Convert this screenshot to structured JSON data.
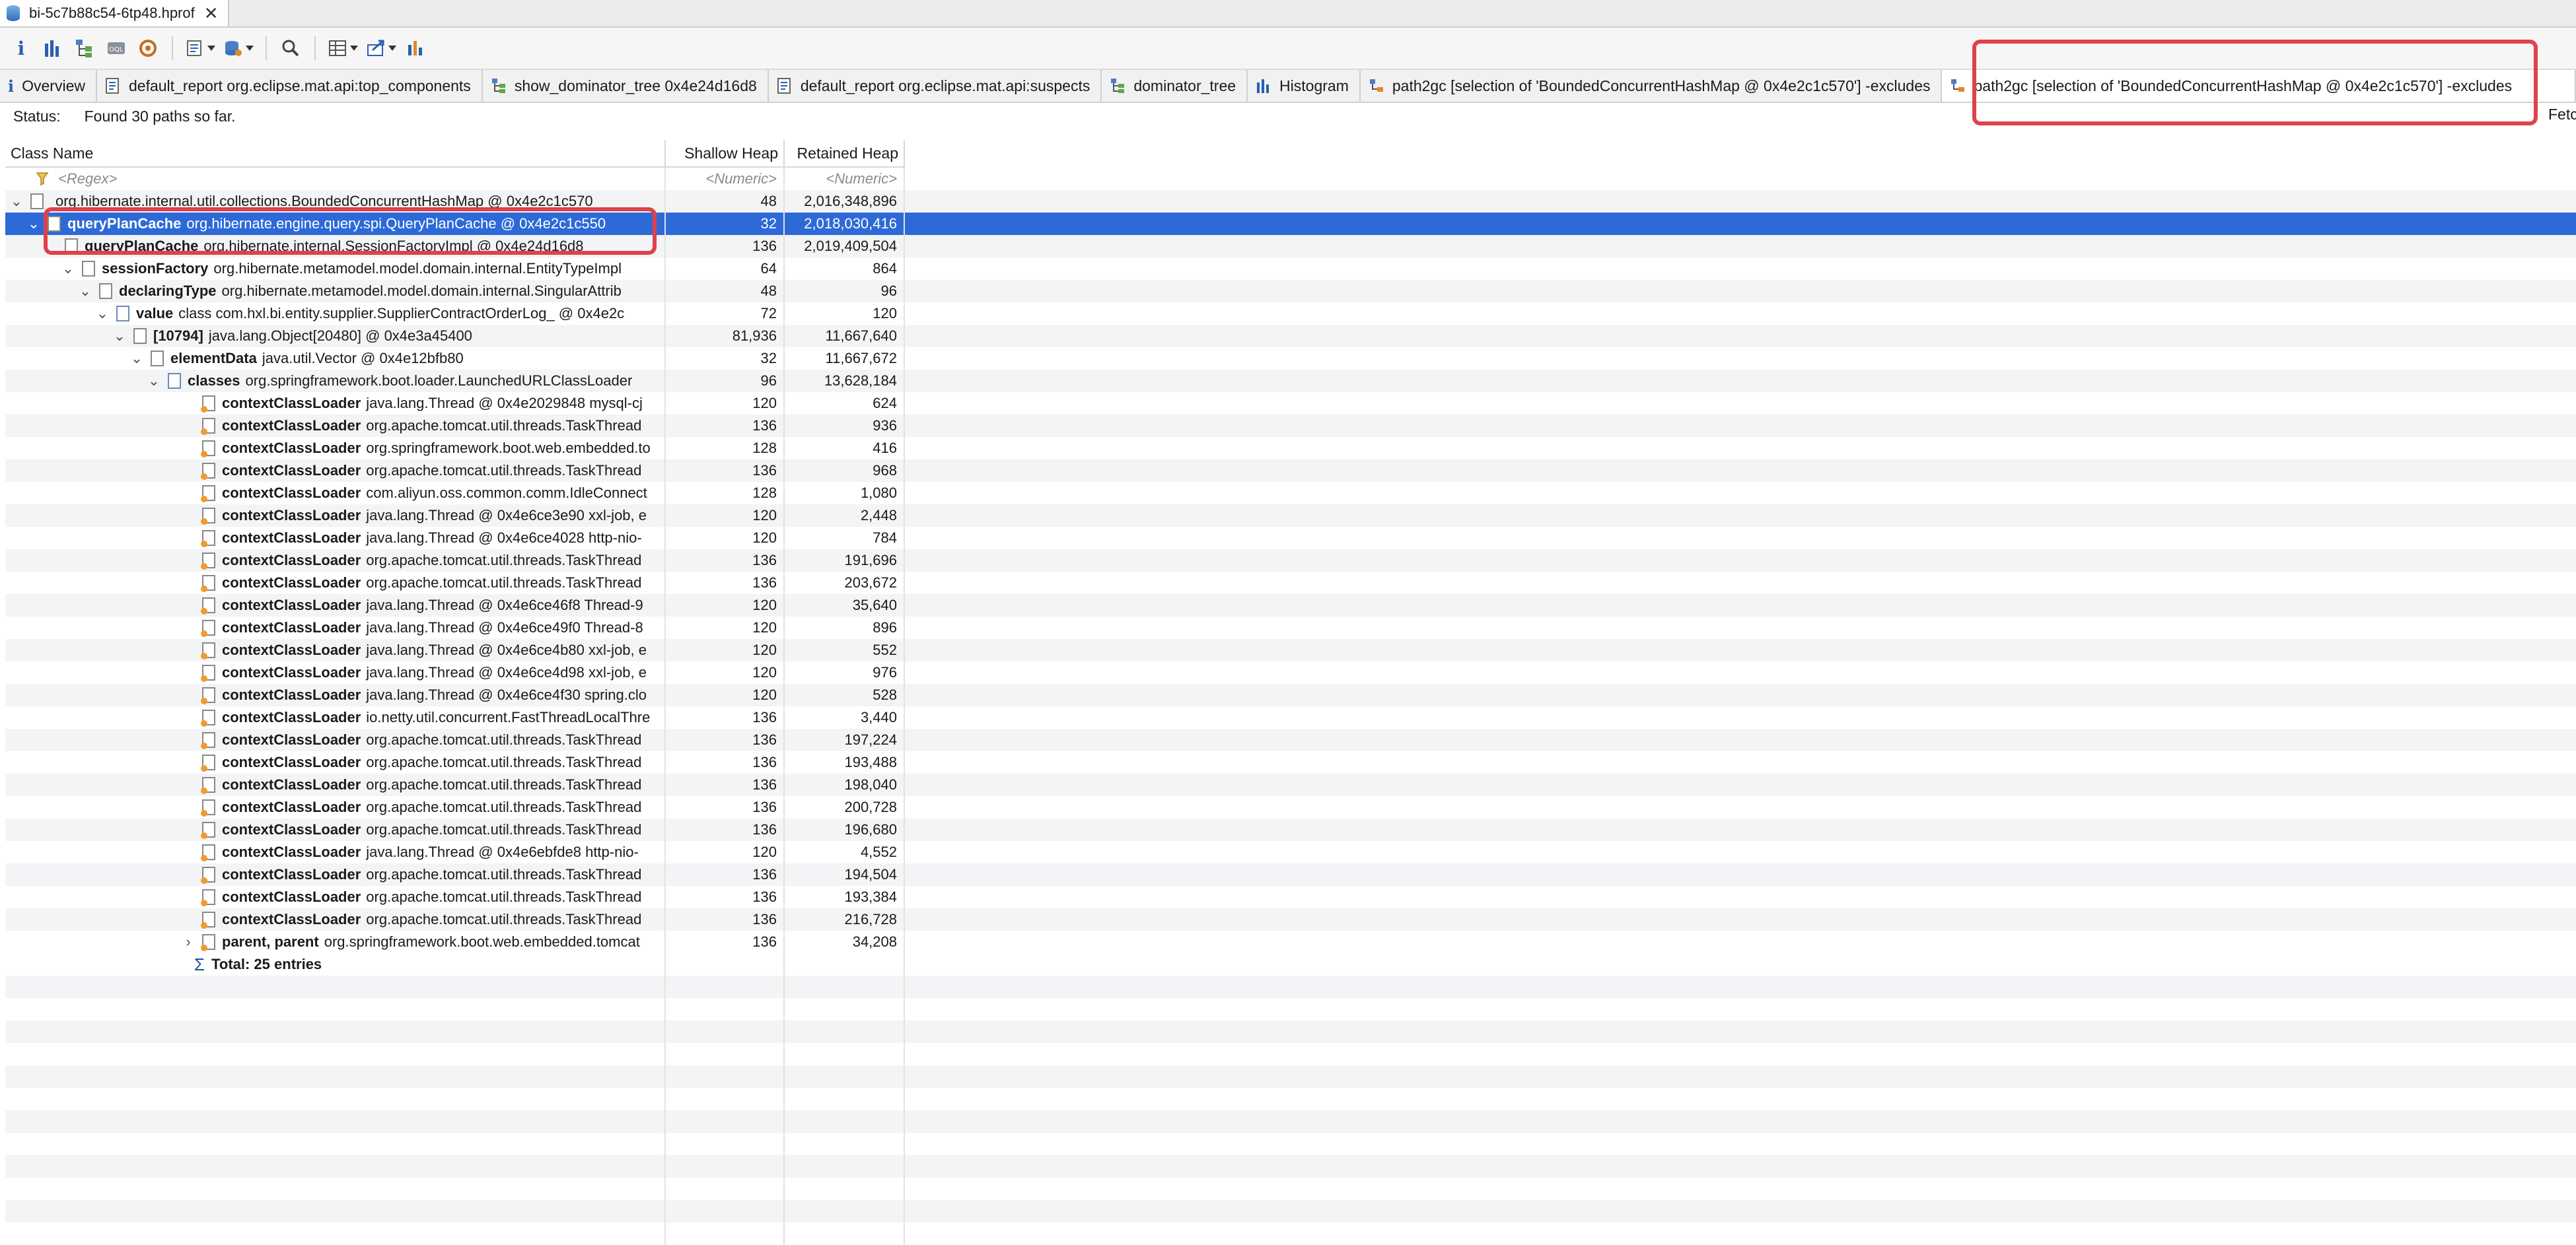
{
  "file_tab": {
    "title": "bi-5c7b88c54-6tp48.hprof",
    "close": "✕"
  },
  "toolbar": {
    "icons": [
      "info-icon",
      "histogram-icon",
      "dominator-tree-icon",
      "oql-icon",
      "thread-overview-icon",
      "run-report-icon",
      "query-browser-icon",
      "search-icon",
      "grouping-icon",
      "export-icon",
      "compare-icon"
    ]
  },
  "tabs": [
    {
      "label": "Overview",
      "icon": "info-icon"
    },
    {
      "label": "default_report org.eclipse.mat.api:top_components",
      "icon": "report-icon"
    },
    {
      "label": "show_dominator_tree 0x4e24d16d8",
      "icon": "dominator-tree-icon"
    },
    {
      "label": "default_report org.eclipse.mat.api:suspects",
      "icon": "report-icon"
    },
    {
      "label": "dominator_tree",
      "icon": "dominator-tree-icon"
    },
    {
      "label": "Histogram",
      "icon": "histogram-icon"
    },
    {
      "label": "path2gc [selection of 'BoundedConcurrentHashMap @ 0x4e2c1c570'] -excludes",
      "icon": "path2gc-icon"
    },
    {
      "label": "path2gc [selection of 'BoundedConcurrentHashMap @ 0x4e2c1c570'] -excludes",
      "icon": "path2gc-icon"
    }
  ],
  "status": {
    "label": "Status:",
    "text": "Found 30 paths so far.",
    "fetch": "Fetc"
  },
  "columns": {
    "class_name": "Class Name",
    "shallow": "Shallow Heap",
    "retained": "Retained Heap"
  },
  "filter": {
    "regex": "<Regex>",
    "numeric1": "<Numeric>",
    "numeric2": "<Numeric>"
  },
  "rows": [
    {
      "field": "",
      "cls": "org.hibernate.internal.util.collections.BoundedConcurrentHashMap @ 0x4e2c1c570",
      "shallow": "48",
      "retained": "2,016,348,896"
    },
    {
      "field": "queryPlanCache",
      "cls": "org.hibernate.engine.query.spi.QueryPlanCache @ 0x4e2c1c550",
      "shallow": "32",
      "retained": "2,018,030,416"
    },
    {
      "field": "queryPlanCache",
      "cls": "org.hibernate.internal.SessionFactoryImpl @ 0x4e24d16d8",
      "shallow": "136",
      "retained": "2,019,409,504"
    },
    {
      "field": "sessionFactory",
      "cls": "org.hibernate.metamodel.model.domain.internal.EntityTypeImpl",
      "shallow": "64",
      "retained": "864"
    },
    {
      "field": "declaringType",
      "cls": "org.hibernate.metamodel.model.domain.internal.SingularAttrib",
      "shallow": "48",
      "retained": "96"
    },
    {
      "field": "value",
      "cls": "class com.hxl.bi.entity.supplier.SupplierContractOrderLog_ @ 0x4e2c",
      "shallow": "72",
      "retained": "120"
    },
    {
      "field": "[10794]",
      "cls": "java.lang.Object[20480] @ 0x4e3a45400",
      "shallow": "81,936",
      "retained": "11,667,640"
    },
    {
      "field": "elementData",
      "cls": "java.util.Vector @ 0x4e12bfb80",
      "shallow": "32",
      "retained": "11,667,672"
    },
    {
      "field": "classes",
      "cls": "org.springframework.boot.loader.LaunchedURLClassLoader",
      "shallow": "96",
      "retained": "13,628,184"
    },
    {
      "field": "contextClassLoader",
      "cls": "java.lang.Thread @ 0x4e2029848  mysql-cj",
      "shallow": "120",
      "retained": "624"
    },
    {
      "field": "contextClassLoader",
      "cls": "org.apache.tomcat.util.threads.TaskThread",
      "shallow": "136",
      "retained": "936"
    },
    {
      "field": "contextClassLoader",
      "cls": "org.springframework.boot.web.embedded.to",
      "shallow": "128",
      "retained": "416"
    },
    {
      "field": "contextClassLoader",
      "cls": "org.apache.tomcat.util.threads.TaskThread",
      "shallow": "136",
      "retained": "968"
    },
    {
      "field": "contextClassLoader",
      "cls": "com.aliyun.oss.common.comm.IdleConnect",
      "shallow": "128",
      "retained": "1,080"
    },
    {
      "field": "contextClassLoader",
      "cls": "java.lang.Thread @ 0x4e6ce3e90  xxl-job, e",
      "shallow": "120",
      "retained": "2,448"
    },
    {
      "field": "contextClassLoader",
      "cls": "java.lang.Thread @ 0x4e6ce4028  http-nio-",
      "shallow": "120",
      "retained": "784"
    },
    {
      "field": "contextClassLoader",
      "cls": "org.apache.tomcat.util.threads.TaskThread",
      "shallow": "136",
      "retained": "191,696"
    },
    {
      "field": "contextClassLoader",
      "cls": "org.apache.tomcat.util.threads.TaskThread",
      "shallow": "136",
      "retained": "203,672"
    },
    {
      "field": "contextClassLoader",
      "cls": "java.lang.Thread @ 0x4e6ce46f8  Thread-9",
      "shallow": "120",
      "retained": "35,640"
    },
    {
      "field": "contextClassLoader",
      "cls": "java.lang.Thread @ 0x4e6ce49f0  Thread-8",
      "shallow": "120",
      "retained": "896"
    },
    {
      "field": "contextClassLoader",
      "cls": "java.lang.Thread @ 0x4e6ce4b80  xxl-job, e",
      "shallow": "120",
      "retained": "552"
    },
    {
      "field": "contextClassLoader",
      "cls": "java.lang.Thread @ 0x4e6ce4d98  xxl-job, e",
      "shallow": "120",
      "retained": "976"
    },
    {
      "field": "contextClassLoader",
      "cls": "java.lang.Thread @ 0x4e6ce4f30  spring.clo",
      "shallow": "120",
      "retained": "528"
    },
    {
      "field": "contextClassLoader",
      "cls": "io.netty.util.concurrent.FastThreadLocalThre",
      "shallow": "136",
      "retained": "3,440"
    },
    {
      "field": "contextClassLoader",
      "cls": "org.apache.tomcat.util.threads.TaskThread",
      "shallow": "136",
      "retained": "197,224"
    },
    {
      "field": "contextClassLoader",
      "cls": "org.apache.tomcat.util.threads.TaskThread",
      "shallow": "136",
      "retained": "193,488"
    },
    {
      "field": "contextClassLoader",
      "cls": "org.apache.tomcat.util.threads.TaskThread",
      "shallow": "136",
      "retained": "198,040"
    },
    {
      "field": "contextClassLoader",
      "cls": "org.apache.tomcat.util.threads.TaskThread",
      "shallow": "136",
      "retained": "200,728"
    },
    {
      "field": "contextClassLoader",
      "cls": "org.apache.tomcat.util.threads.TaskThread",
      "shallow": "136",
      "retained": "196,680"
    },
    {
      "field": "contextClassLoader",
      "cls": "java.lang.Thread @ 0x4e6ebfde8  http-nio-",
      "shallow": "120",
      "retained": "4,552"
    },
    {
      "field": "contextClassLoader",
      "cls": "org.apache.tomcat.util.threads.TaskThread",
      "shallow": "136",
      "retained": "194,504"
    },
    {
      "field": "contextClassLoader",
      "cls": "org.apache.tomcat.util.threads.TaskThread",
      "shallow": "136",
      "retained": "193,384"
    },
    {
      "field": "contextClassLoader",
      "cls": "org.apache.tomcat.util.threads.TaskThread",
      "shallow": "136",
      "retained": "216,728"
    },
    {
      "field": "parent, parent",
      "cls": "org.springframework.boot.web.embedded.tomcat",
      "shallow": "136",
      "retained": "34,208"
    }
  ],
  "total": "Total: 25 entries",
  "colors": {
    "selection": "#2d6ad8",
    "callout": "#e0414a"
  }
}
